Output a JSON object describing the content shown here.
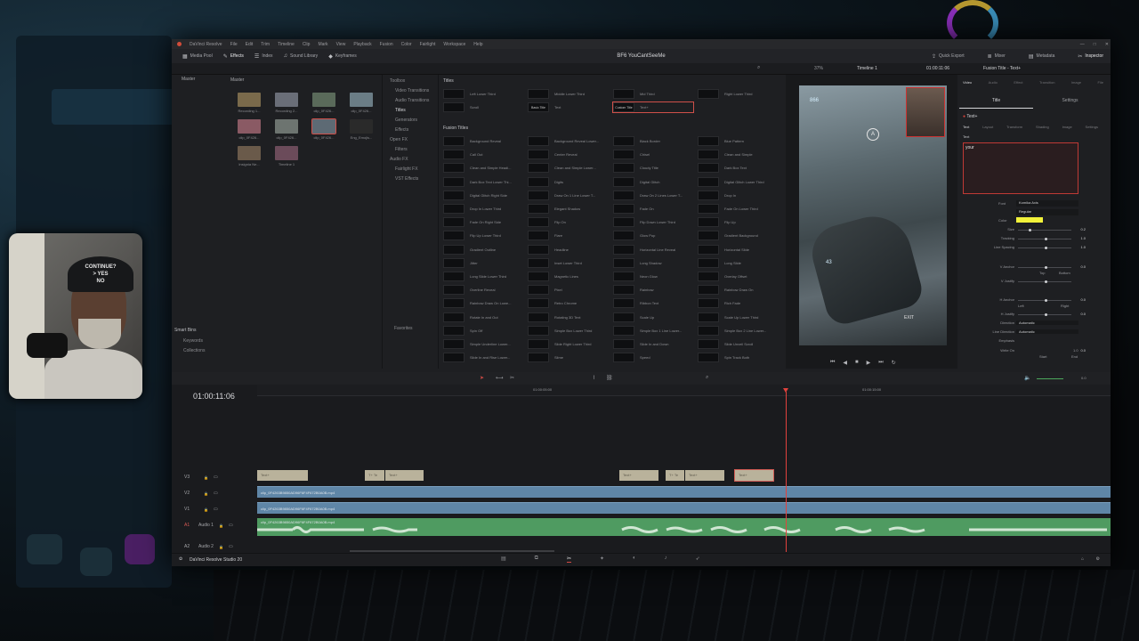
{
  "app": {
    "menu": [
      "DaVinci Resolve",
      "File",
      "Edit",
      "Trim",
      "Timeline",
      "Clip",
      "Mark",
      "View",
      "Playback",
      "Fusion",
      "Color",
      "Fairlight",
      "Workspace",
      "Help"
    ],
    "project_title": "BF6 YouCantSeeMe",
    "brand": "DaVinci Resolve Studio 20"
  },
  "toolbar": {
    "left": [
      {
        "icon": "media-pool-icon",
        "label": "Media Pool"
      },
      {
        "icon": "effects-icon",
        "label": "Effects"
      },
      {
        "icon": "index-icon",
        "label": "Index"
      },
      {
        "icon": "sound-library-icon",
        "label": "Sound Library"
      },
      {
        "icon": "keyframes-icon",
        "label": "Keyframes"
      }
    ],
    "right": [
      {
        "icon": "quick-export-icon",
        "label": "Quick Export"
      },
      {
        "icon": "mixer-icon",
        "label": "Mixer"
      },
      {
        "icon": "metadata-icon",
        "label": "Metadata"
      },
      {
        "icon": "inspector-icon",
        "label": "Inspector"
      }
    ],
    "zoom": "37%",
    "timeline_name": "Timeline 1",
    "source_tc": "00:00:31:34",
    "viewer_tc": "01:00:11:06",
    "inspector_title": "Fusion Title - Text+"
  },
  "media_pool": {
    "bin_root": "Master",
    "header": "Master",
    "clips": [
      {
        "label": "Recording 1..."
      },
      {
        "label": "Recording 2..."
      },
      {
        "label": "clip_0F426..."
      },
      {
        "label": "clip_0F426..."
      },
      {
        "label": "clip_0F426..."
      },
      {
        "label": "clip_0F426..."
      },
      {
        "label": "clip_0F426..."
      },
      {
        "label": "Eng_Emojis..."
      },
      {
        "label": "Insignia Ne..."
      },
      {
        "label": "Timeline 1"
      }
    ],
    "smart_bins_label": "Smart Bins",
    "smart_bins": [
      "Keywords",
      "Collections"
    ]
  },
  "effects_tree": {
    "items": [
      "Toolbox",
      "Video Transitions",
      "Audio Transitions",
      "Titles",
      "Generators",
      "Effects",
      "Open FX",
      "Filters",
      "Audio FX",
      "Fairlight FX",
      "VST Effects"
    ],
    "selected": "Titles",
    "favorites": "Favorites"
  },
  "titles": {
    "section1": "Titles",
    "row1": [
      "Left Lower Third",
      "Middle Lower Third",
      "Mid Third",
      "Right Lower Third"
    ],
    "row2": [
      "Scroll",
      "Text",
      "Text+"
    ],
    "row2_thumbs": [
      "",
      "Basic Title",
      "Custom Title"
    ],
    "section2": "Fusion Titles",
    "fusion": [
      [
        "Background Reveal",
        "Background Reveal Lower...",
        "Black Border",
        "Blue Pattern"
      ],
      [
        "Call Out",
        "Center Reveal",
        "Chisel",
        "Clean and Simple"
      ],
      [
        "Clean and Simple Headi...",
        "Clean and Simple Lower...",
        "Cloudy Title",
        "Dark Box Text"
      ],
      [
        "Dark Box Text Lower Thi...",
        "Digits",
        "Digital Glitch",
        "Digital Glitch Lower Third"
      ],
      [
        "Digital Glitch Right Side",
        "Draw On 1 Line Lower T...",
        "Draw On 2 Lines Lower T...",
        "Drop In"
      ],
      [
        "Drop In Lower Third",
        "Elegant Shadow",
        "Fade On",
        "Fade On Lower Third"
      ],
      [
        "Fade On Right Side",
        "Flip On",
        "Flip Down Lower Third",
        "Flip Up"
      ],
      [
        "Flip Up Lower Third",
        "Flare",
        "Glow Pop",
        "Gradient Background"
      ],
      [
        "Gradient Outline",
        "Headline",
        "Horizontal Line Reveal",
        "Horizontal Slide"
      ],
      [
        "Jitter",
        "Inset Lower Third",
        "Long Shadow",
        "Long Slide"
      ],
      [
        "Long Slide Lower Third",
        "Magnetic Lines",
        "Neon Glow",
        "Overlay Offset"
      ],
      [
        "Overline Reveal",
        "Pixel",
        "Rainbow",
        "Rainbow Draw On"
      ],
      [
        "Rainbow Draw On Lowe...",
        "Retro Chrome",
        "Ribbon Text",
        "Rich Fade"
      ],
      [
        "Rotate In and Out",
        "Rotating 3D Text",
        "Scale Up",
        "Scale Up Lower Third"
      ],
      [
        "Spin Off",
        "Simple Box Lower Third",
        "Simple Box 1 Line Lower...",
        "Simple Box 2 Line Lower..."
      ],
      [
        "Simple Underline Lower...",
        "Slide Right Lower Third",
        "Slide In and Down",
        "Slide Unveil Scroll"
      ],
      [
        "Slide In and Rise Lower...",
        "Slime",
        "Speed",
        "Spin Track Both"
      ]
    ]
  },
  "viewer": {
    "hud_value": "866",
    "button_a": "A",
    "exit_label": "EXIT",
    "counter": "4",
    "overlay_text": "43"
  },
  "inspector": {
    "tabs": [
      "Video",
      "Audio",
      "Effect",
      "Transition",
      "Image",
      "File"
    ],
    "active_tab": "Video",
    "sub_tabs": [
      "Title",
      "Settings"
    ],
    "tool_name": "Text+",
    "text_tabs": [
      "Text",
      "Layout",
      "Transform",
      "Shading",
      "Image",
      "Settings"
    ],
    "text_section": "Text",
    "styled_text": "your",
    "font": "Komika Axis",
    "style": "Regular",
    "color_label": "Color",
    "color_value": "#f2f23a",
    "size_label": "Size",
    "size_value": "0.2",
    "tracking_label": "Tracking",
    "tracking_value": "1.0",
    "line_spacing_label": "Line Spacing",
    "line_spacing_value": "1.0",
    "v_anchor_label": "V Anchor",
    "v_anchor_value": "0.0",
    "v_anchor_left": "Top",
    "v_anchor_right": "Bottom",
    "v_justify_label": "V Justify",
    "h_anchor_label": "H Anchor",
    "h_anchor_value": "0.0",
    "h_anchor_left": "Left",
    "h_anchor_right": "Right",
    "h_justify_label": "H Justify",
    "h_justify_value": "0.0",
    "direction_label": "Direction",
    "direction_value": "Automatic",
    "line_direction_label": "Line Direction",
    "line_direction_value": "Automatic",
    "emphasis_label": "Emphasis",
    "write_on_label": "Write On",
    "write_on_start": "0.0",
    "write_on_end": "1.0",
    "write_on_left": "Start",
    "write_on_right": "End"
  },
  "timeline": {
    "timecode": "01:00:11:06",
    "ruler_marks": [
      "01:00:05:00",
      "01:00:15:00"
    ],
    "tracks": [
      {
        "id": "V3",
        "name": ""
      },
      {
        "id": "V2",
        "name": ""
      },
      {
        "id": "V1",
        "name": ""
      },
      {
        "id": "A1",
        "name": "Audio 1"
      },
      {
        "id": "A2",
        "name": "Audio 2"
      }
    ],
    "title_clip_label": "Text+",
    "title_clip_label_short": "T+ Te",
    "v2_clip": "clip_0F4263B9850AD96F6F4F672B0A0B.mp4",
    "v1_clip": "clip_0F4263B9850AD96F6F4F672B0A0B.mp4",
    "a1_clip": "clip_0F4263B9850AD96F6F4F672B0A0B.mp4",
    "volume_value": "0.0"
  },
  "webcam": {
    "cap_line1": "CONTINUE?",
    "cap_line2": "> YES",
    "cap_line3": "NO"
  },
  "pages": [
    "media-page",
    "cut-page",
    "edit-page",
    "fusion-page",
    "color-page",
    "fairlight-page",
    "deliver-page"
  ],
  "active_page": "edit-page"
}
